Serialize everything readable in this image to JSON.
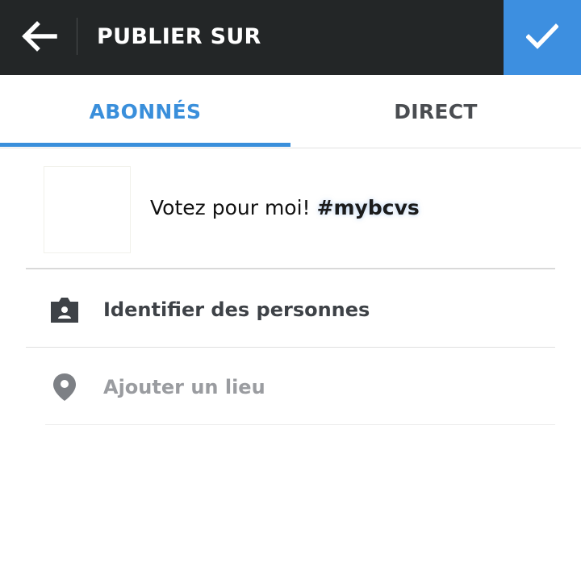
{
  "header": {
    "title": "PUBLIER SUR",
    "back_icon": "arrow-left-icon",
    "confirm_icon": "checkmark-icon",
    "background": "#232627",
    "confirm_color": "#3d8fe0"
  },
  "tabs": [
    {
      "label": "ABONNÉS",
      "active": true
    },
    {
      "label": "DIRECT",
      "active": false
    }
  ],
  "accent_color": "#3a8fdb",
  "post": {
    "caption": "Votez pour moi!",
    "hashtag": "#mybcvs"
  },
  "options": [
    {
      "label": "Identifier des personnes",
      "icon": "tag-person-icon"
    },
    {
      "label": "Ajouter un lieu",
      "icon": "location-pin-icon"
    }
  ]
}
